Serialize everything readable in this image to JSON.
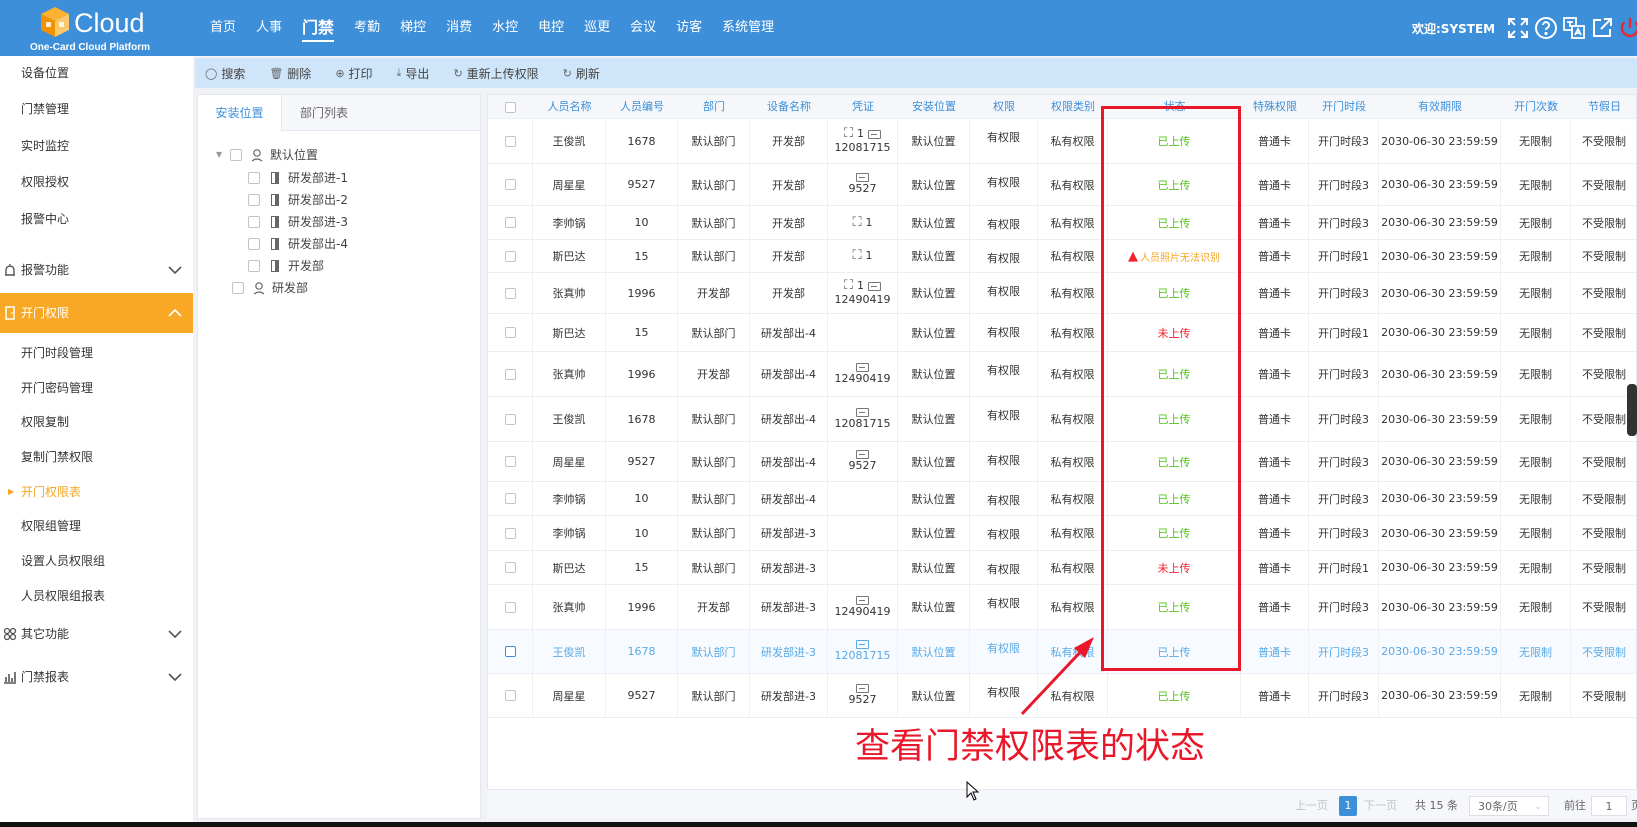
{
  "header": {
    "logo_text": "Cloud",
    "logo_sub": "One-Card Cloud Platform",
    "nav": [
      "首页",
      "人事",
      "门禁",
      "考勤",
      "梯控",
      "消费",
      "水控",
      "电控",
      "巡更",
      "会议",
      "访客",
      "系统管理"
    ],
    "active_nav": "门禁",
    "welcome": "欢迎:SYSTEM",
    "icons": [
      "fullscreen-icon",
      "help-icon",
      "language-icon",
      "external-link-icon",
      "power-icon"
    ]
  },
  "sidebar": {
    "items_top": [
      "设备位置",
      "门禁管理",
      "实时监控",
      "权限授权",
      "报警中心"
    ],
    "group_alarm": "报警功能",
    "group_open": "开门权限",
    "items_open": [
      "开门时段管理",
      "开门密码管理",
      "权限复制",
      "复制门禁权限",
      "开门权限表",
      "权限组管理",
      "设置人员权限组",
      "人员权限组报表"
    ],
    "current": "开门权限表",
    "group_other": "其它功能",
    "group_report": "门禁报表"
  },
  "toolbar": {
    "buttons": [
      "搜索",
      "删除",
      "打印",
      "导出",
      "重新上传权限",
      "刷新"
    ],
    "icons": [
      "◯",
      "🗑",
      "⊕",
      "⤓",
      "↻",
      "↻"
    ]
  },
  "tree": {
    "tabs": [
      "安装位置",
      "部门列表"
    ],
    "root": "默认位置",
    "children": [
      "研发部进-1",
      "研发部出-2",
      "研发部进-3",
      "研发部出-4",
      "开发部"
    ],
    "root2": "研发部"
  },
  "table": {
    "columns": [
      "人员名称",
      "人员编号",
      "部门",
      "设备名称",
      "凭证",
      "安装位置",
      "权限",
      "权限类别",
      "状态",
      "特殊权限",
      "开门时段",
      "有效期限",
      "开门次数",
      "节假日"
    ],
    "rows": [
      {
        "name": "王俊凯",
        "no": "1678",
        "dept": "默认部门",
        "device": "开发部",
        "face": true,
        "card": true,
        "cred_no": "12081715",
        "loc": "默认位置",
        "perm": "有权限",
        "ptype": "私有权限",
        "status": "已上传",
        "st": "ok",
        "special": "普通卡",
        "period": "开门时段3",
        "expire": "2030-06-30 23:59:59",
        "times": "无限制",
        "holiday": "不受限制"
      },
      {
        "name": "周星星",
        "no": "9527",
        "dept": "默认部门",
        "device": "开发部",
        "face": false,
        "card": true,
        "cred_no": "9527",
        "loc": "默认位置",
        "perm": "有权限",
        "ptype": "私有权限",
        "status": "已上传",
        "st": "ok",
        "special": "普通卡",
        "period": "开门时段3",
        "expire": "2030-06-30 23:59:59",
        "times": "无限制",
        "holiday": "不受限制"
      },
      {
        "name": "李帅锅",
        "no": "10",
        "dept": "默认部门",
        "device": "开发部",
        "face": true,
        "card": false,
        "cred_no": "",
        "loc": "默认位置",
        "perm": "有权限",
        "ptype": "私有权限",
        "status": "已上传",
        "st": "ok",
        "special": "普通卡",
        "period": "开门时段3",
        "expire": "2030-06-30 23:59:59",
        "times": "无限制",
        "holiday": "不受限制"
      },
      {
        "name": "斯巴达",
        "no": "15",
        "dept": "默认部门",
        "device": "开发部",
        "face": true,
        "card": false,
        "cred_no": "",
        "loc": "默认位置",
        "perm": "有权限",
        "ptype": "私有权限",
        "status": "人员照片无法识别",
        "st": "warn",
        "special": "普通卡",
        "period": "开门时段1",
        "expire": "2030-06-30 23:59:59",
        "times": "无限制",
        "holiday": "不受限制"
      },
      {
        "name": "张真帅",
        "no": "1996",
        "dept": "开发部",
        "device": "开发部",
        "face": true,
        "card": true,
        "cred_no": "12490419",
        "loc": "默认位置",
        "perm": "有权限",
        "ptype": "私有权限",
        "status": "已上传",
        "st": "ok",
        "special": "普通卡",
        "period": "开门时段3",
        "expire": "2030-06-30 23:59:59",
        "times": "无限制",
        "holiday": "不受限制"
      },
      {
        "name": "斯巴达",
        "no": "15",
        "dept": "默认部门",
        "device": "研发部出-4",
        "face": false,
        "card": false,
        "cred_no": "",
        "loc": "默认位置",
        "perm": "有权限",
        "ptype": "私有权限",
        "status": "未上传",
        "st": "no",
        "special": "普通卡",
        "period": "开门时段1",
        "expire": "2030-06-30 23:59:59",
        "times": "无限制",
        "holiday": "不受限制"
      },
      {
        "name": "张真帅",
        "no": "1996",
        "dept": "开发部",
        "device": "研发部出-4",
        "face": false,
        "card": true,
        "cred_no": "12490419",
        "loc": "默认位置",
        "perm": "有权限",
        "ptype": "私有权限",
        "status": "已上传",
        "st": "ok",
        "special": "普通卡",
        "period": "开门时段3",
        "expire": "2030-06-30 23:59:59",
        "times": "无限制",
        "holiday": "不受限制"
      },
      {
        "name": "王俊凯",
        "no": "1678",
        "dept": "默认部门",
        "device": "研发部出-4",
        "face": false,
        "card": true,
        "cred_no": "12081715",
        "loc": "默认位置",
        "perm": "有权限",
        "ptype": "私有权限",
        "status": "已上传",
        "st": "ok",
        "special": "普通卡",
        "period": "开门时段3",
        "expire": "2030-06-30 23:59:59",
        "times": "无限制",
        "holiday": "不受限制"
      },
      {
        "name": "周星星",
        "no": "9527",
        "dept": "默认部门",
        "device": "研发部出-4",
        "face": false,
        "card": true,
        "cred_no": "9527",
        "loc": "默认位置",
        "perm": "有权限",
        "ptype": "私有权限",
        "status": "已上传",
        "st": "ok",
        "special": "普通卡",
        "period": "开门时段3",
        "expire": "2030-06-30 23:59:59",
        "times": "无限制",
        "holiday": "不受限制"
      },
      {
        "name": "李帅锅",
        "no": "10",
        "dept": "默认部门",
        "device": "研发部出-4",
        "face": false,
        "card": false,
        "cred_no": "",
        "loc": "默认位置",
        "perm": "有权限",
        "ptype": "私有权限",
        "status": "已上传",
        "st": "ok",
        "special": "普通卡",
        "period": "开门时段3",
        "expire": "2030-06-30 23:59:59",
        "times": "无限制",
        "holiday": "不受限制"
      },
      {
        "name": "李帅锅",
        "no": "10",
        "dept": "默认部门",
        "device": "研发部进-3",
        "face": false,
        "card": false,
        "cred_no": "",
        "loc": "默认位置",
        "perm": "有权限",
        "ptype": "私有权限",
        "status": "已上传",
        "st": "ok",
        "special": "普通卡",
        "period": "开门时段3",
        "expire": "2030-06-30 23:59:59",
        "times": "无限制",
        "holiday": "不受限制"
      },
      {
        "name": "斯巴达",
        "no": "15",
        "dept": "默认部门",
        "device": "研发部进-3",
        "face": false,
        "card": false,
        "cred_no": "",
        "loc": "默认位置",
        "perm": "有权限",
        "ptype": "私有权限",
        "status": "未上传",
        "st": "no",
        "special": "普通卡",
        "period": "开门时段1",
        "expire": "2030-06-30 23:59:59",
        "times": "无限制",
        "holiday": "不受限制"
      },
      {
        "name": "张真帅",
        "no": "1996",
        "dept": "开发部",
        "device": "研发部进-3",
        "face": false,
        "card": true,
        "cred_no": "12490419",
        "loc": "默认位置",
        "perm": "有权限",
        "ptype": "私有权限",
        "status": "已上传",
        "st": "ok",
        "special": "普通卡",
        "period": "开门时段3",
        "expire": "2030-06-30 23:59:59",
        "times": "无限制",
        "holiday": "不受限制"
      },
      {
        "name": "王俊凯",
        "no": "1678",
        "dept": "默认部门",
        "device": "研发部进-3",
        "face": false,
        "card": true,
        "cred_no": "12081715",
        "loc": "默认位置",
        "perm": "有权限",
        "ptype": "私有权限",
        "status": "已上传",
        "st": "ok",
        "special": "普通卡",
        "period": "开门时段3",
        "expire": "2030-06-30 23:59:59",
        "times": "无限制",
        "holiday": "不受限制"
      },
      {
        "name": "周星星",
        "no": "9527",
        "dept": "默认部门",
        "device": "研发部进-3",
        "face": false,
        "card": true,
        "cred_no": "9527",
        "loc": "默认位置",
        "perm": "有权限",
        "ptype": "私有权限",
        "status": "已上传",
        "st": "ok",
        "special": "普通卡",
        "period": "开门时段3",
        "expire": "2030-06-30 23:59:59",
        "times": "无限制",
        "holiday": "不受限制"
      }
    ]
  },
  "pager": {
    "prev": "上一页",
    "current": "1",
    "next": "下一页",
    "total": "共 15 条",
    "per_page": "30条/页",
    "goto_label": "前往",
    "goto_value": "1",
    "page_unit": "页"
  },
  "annotation": {
    "text": "查看门禁权限表的状态",
    "color": "#e8182a"
  },
  "colors": {
    "header": "#3d8fd9",
    "active_group": "#f9a825",
    "ok": "#52c41a",
    "no": "#f5222d",
    "warn": "#f5a623"
  }
}
